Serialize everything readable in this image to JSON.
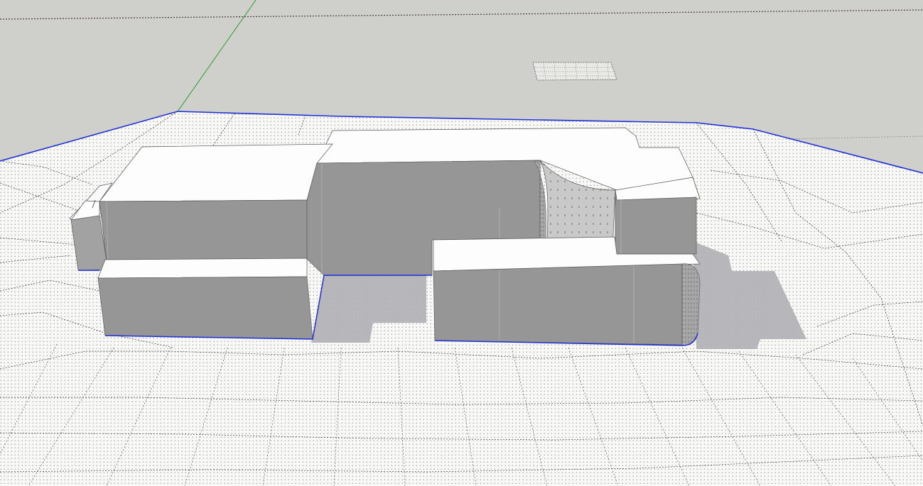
{
  "app": {
    "window_kind": "3d-modeling-viewport",
    "view": "perspective"
  },
  "colors": {
    "sky": "#cfd0cc",
    "ground": "#f7f7f5",
    "terrain_outline": "#1f2fd6",
    "building_top": "#fdfdfd",
    "building_side": "#969696",
    "building_side_light": "#a9a9a9",
    "shadow": "#b2b2b6",
    "x_axis": "#5a3a3a",
    "y_axis": "#2f9a2f",
    "terrain_mesh": "#3a3a3a"
  },
  "scene": {
    "ground_label": "terrain",
    "model_label": "building",
    "hidden_geometry_visible": true,
    "shadows_visible": true
  }
}
